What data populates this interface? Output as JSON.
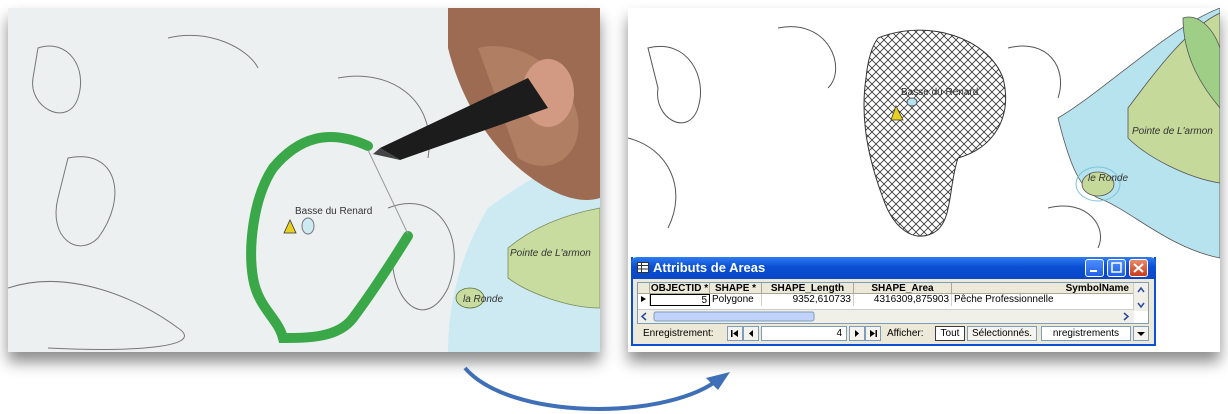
{
  "left_map": {
    "place_basse": "Basse du Renard",
    "place_pointe": "Pointe de L'armon",
    "place_ronde": "la Ronde"
  },
  "right_map": {
    "place_basse": "Basse du Renard",
    "place_pointe": "Pointe de L'armon",
    "place_ronde": "le Ronde"
  },
  "window": {
    "title": "Attributs de  Areas",
    "columns": [
      "OBJECTID *",
      "SHAPE *",
      "SHAPE_Length",
      "SHAPE_Area",
      "SymbolName"
    ],
    "row": {
      "objectid": "5",
      "shape": "Polygone",
      "shape_length": "9352,610733",
      "shape_area": "4316309,875903",
      "symbol_name": "Pêche Professionnelle"
    },
    "record_label": "Enregistrement:",
    "record_value": "4",
    "show_label": "Afficher:",
    "show_all": "Tout",
    "show_selected": "Sélectionnés.",
    "records_text": "nregistrements"
  },
  "colors": {
    "window_blue": "#0a4fd4",
    "stroke_green": "#3aa748",
    "water_light": "#b7e3ef",
    "land_green": "#c5d99a"
  }
}
